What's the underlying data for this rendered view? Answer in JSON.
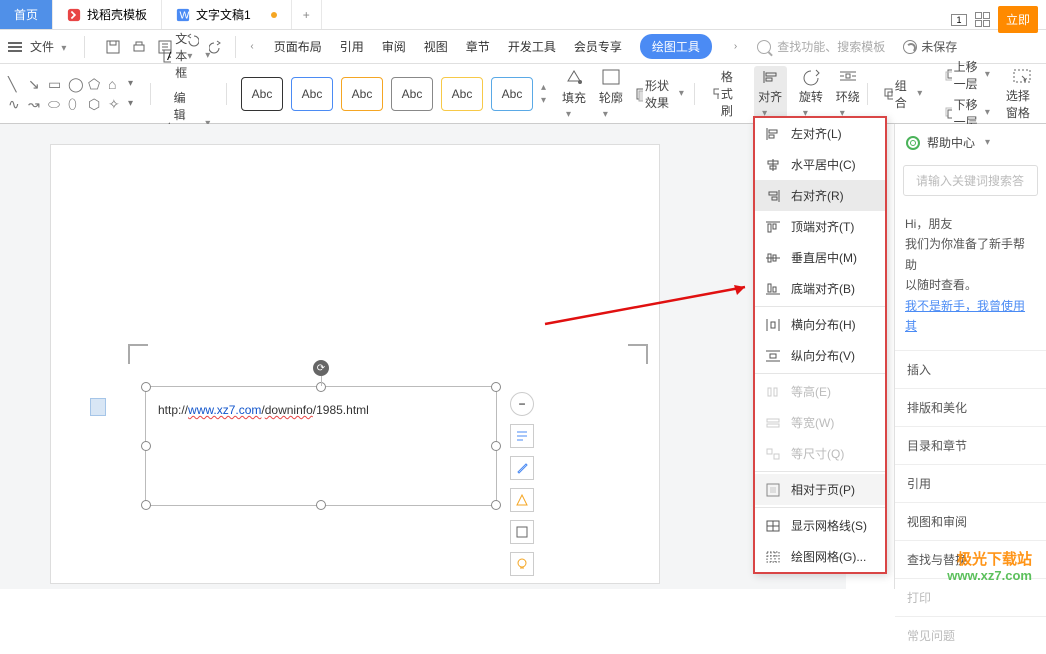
{
  "tabs": {
    "home": "首页",
    "template": "找稻壳模板",
    "doc": "文字文稿1"
  },
  "topright": {
    "immediate": "立即"
  },
  "menu": {
    "file": "文件"
  },
  "ribbon_tabs": [
    "页面布局",
    "引用",
    "审阅",
    "视图",
    "章节",
    "开发工具",
    "会员专享"
  ],
  "draw_tool": "绘图工具",
  "search_ph": "查找功能、搜索模板",
  "unsaved": "未保存",
  "textbox": "文本框",
  "editshape": "编辑形状",
  "abc": "Abc",
  "fill": "填充",
  "outline": "轮廓",
  "effect": "形状效果",
  "fmtpaint": "格式刷",
  "align": "对齐",
  "rotate": "旋转",
  "wrap": "环绕",
  "group": "组合",
  "upone": "上移一层",
  "downone": "下移一层",
  "selpane": "选择窗格",
  "url": {
    "p1": "http://",
    "p2": "www.xz7.com",
    "p3": "/",
    "p4": "downinfo",
    "p5": "/1985.html"
  },
  "alignmenu": {
    "left": "左对齐(L)",
    "hcenter": "水平居中(C)",
    "right": "右对齐(R)",
    "top": "顶端对齐(T)",
    "vcenter": "垂直居中(M)",
    "bottom": "底端对齐(B)",
    "hdist": "横向分布(H)",
    "vdist": "纵向分布(V)",
    "eqh": "等高(E)",
    "eqw": "等宽(W)",
    "eqs": "等尺寸(Q)",
    "relpage": "相对于页(P)",
    "grid": "显示网格线(S)",
    "drawgrid": "绘图网格(G)..."
  },
  "panel": {
    "help": "帮助中心",
    "srch_ph": "请输入关键词搜索答",
    "hi": "Hi，朋友",
    "msg": "我们为你准备了新手帮助",
    "msg2": "以随时查看。",
    "link": "我不是新手，我曾使用其",
    "s1": "插入",
    "s2": "排版和美化",
    "s3": "目录和章节",
    "s4": "引用",
    "s5": "视图和审阅",
    "s6": "查找与替换",
    "s7": "打印",
    "s8": "常见问题"
  },
  "wm": {
    "a": "极光下载站",
    "b": "www.xz7.com"
  }
}
